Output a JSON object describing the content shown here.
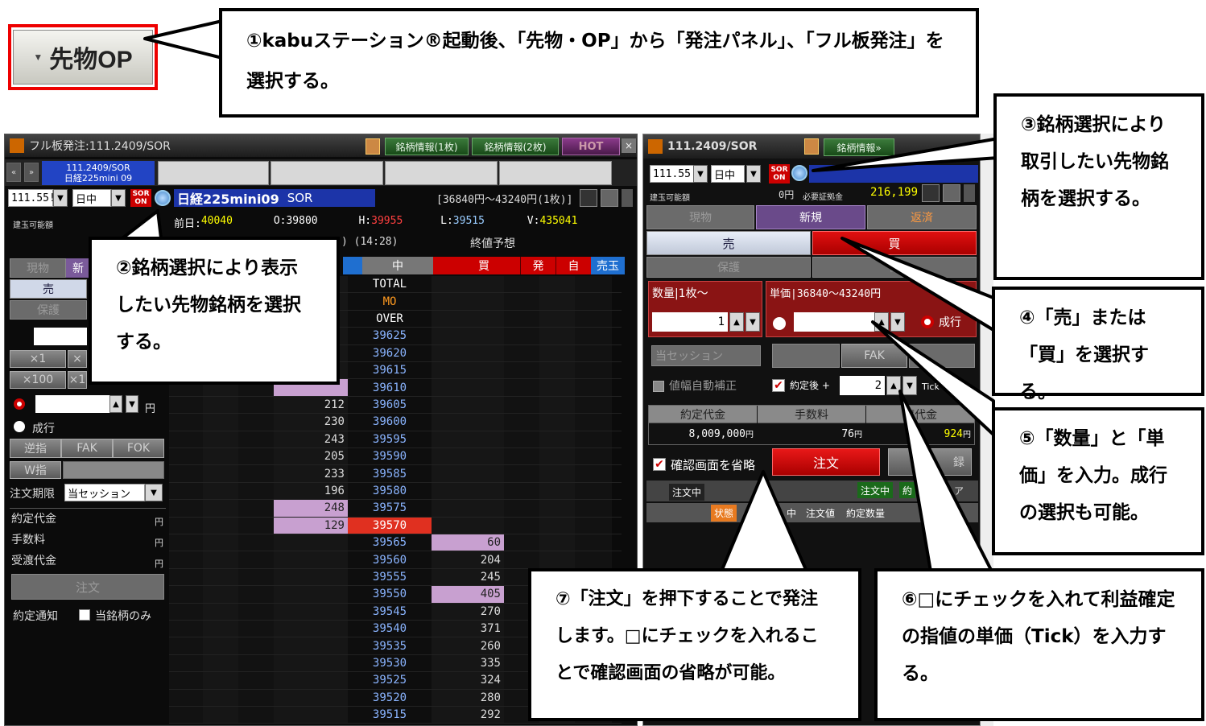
{
  "toolbar_button": {
    "label": "先物OP"
  },
  "left_window": {
    "title": "フル板発注:111.2409/SOR",
    "btn_info1": "銘柄情報(1枚)",
    "btn_info2": "銘柄情報(2枚)",
    "btn_hot": "HOT",
    "close": "×",
    "nav_prev": "«",
    "nav_next": "»",
    "tab_code": "111.2409/SOR",
    "tab_name": "日経225mini 09",
    "code_field": "111.55!",
    "session_select": "日中",
    "sor_label": "SOR ON",
    "symbol_name": "日経225mini09",
    "symbol_sor": "SOR",
    "price_range": "[36840円～43240円(1枚)]",
    "tategyoku": "建玉可能額",
    "prev_close_label": "前日:",
    "prev_close": "40040",
    "open_label": "O:",
    "open": "39800",
    "high_label": "H:",
    "high": "39955",
    "low_label": "L:",
    "low": "39515",
    "volume_label": "V:",
    "volume": "435041",
    "time": ") (14:28)",
    "closing_forecast": "終値予想",
    "panel": {
      "tab_genbutsu": "現物",
      "tab_shinki": "新",
      "sell": "売",
      "hogo": "保護",
      "x1": "×1",
      "x1b": "×",
      "x100": "×100",
      "x100b": "×1",
      "yen": "円",
      "market": "成行",
      "gyakusashi": "逆指",
      "fak": "FAK",
      "fok": "FOK",
      "w_sashi": "W指",
      "period_label": "注文期限",
      "period_value": "当セッション",
      "yakujo": "約定代金",
      "tesuryo": "手数料",
      "jutai": "受渡代金",
      "order": "注文",
      "notice": "約定通知",
      "this_only": "当銘柄のみ"
    },
    "book": {
      "headers": {
        "mid": "中",
        "buy": "買",
        "hatsu": "発",
        "ji": "自",
        "urigyoku": "売玉"
      },
      "rows": [
        {
          "price": "TOTAL",
          "sell": "",
          "buy": ""
        },
        {
          "price": "MO",
          "sell": "",
          "buy": ""
        },
        {
          "price": "OVER",
          "sell": "",
          "buy": ""
        },
        {
          "price": "39625",
          "sell": "",
          "buy": ""
        },
        {
          "price": "39620",
          "sell": "",
          "buy": ""
        },
        {
          "price": "39615",
          "sell": "",
          "buy": ""
        },
        {
          "price": "39610",
          "sell": "",
          "buy": ""
        },
        {
          "price": "39605",
          "sell": "212",
          "buy": ""
        },
        {
          "price": "39600",
          "sell": "230",
          "buy": ""
        },
        {
          "price": "39595",
          "sell": "243",
          "buy": ""
        },
        {
          "price": "39590",
          "sell": "205",
          "buy": ""
        },
        {
          "price": "39585",
          "sell": "233",
          "buy": ""
        },
        {
          "price": "39580",
          "sell": "196",
          "buy": ""
        },
        {
          "price": "39575",
          "sell": "248",
          "buy": ""
        },
        {
          "price": "39570",
          "sell": "129",
          "buy": ""
        },
        {
          "price": "39565",
          "sell": "",
          "buy": "60"
        },
        {
          "price": "39560",
          "sell": "",
          "buy": "204"
        },
        {
          "price": "39555",
          "sell": "",
          "buy": "245"
        },
        {
          "price": "39550",
          "sell": "",
          "buy": "405"
        },
        {
          "price": "39545",
          "sell": "",
          "buy": "270"
        },
        {
          "price": "39540",
          "sell": "",
          "buy": "371"
        },
        {
          "price": "39535",
          "sell": "",
          "buy": "260"
        },
        {
          "price": "39530",
          "sell": "",
          "buy": "335"
        },
        {
          "price": "39525",
          "sell": "",
          "buy": "324"
        },
        {
          "price": "39520",
          "sell": "",
          "buy": "280"
        },
        {
          "price": "39515",
          "sell": "",
          "buy": "292"
        }
      ]
    }
  },
  "right_window": {
    "title": "111.2409/SOR",
    "btn_info": "銘柄情報»",
    "code_field": "111.55!",
    "session_select": "日中",
    "sor_label": "SOR ON",
    "tategyoku": "建玉可能額",
    "zero_yen": "0円",
    "margin_label": "必要証拠金",
    "margin": "216,199",
    "tab_genbutsu": "現物",
    "tab_shinki": "新規",
    "tab_hensai": "返済",
    "sell": "売",
    "buy": "買",
    "hogo": "保護",
    "hogo2": "保",
    "qty_label": "数量|1枚～",
    "qty_value": "1",
    "price_label": "単価|36840～43240円",
    "market": "成行",
    "session": "当セッション",
    "fak": "FAK",
    "auto_adjust": "値幅自動補正",
    "after_fill": "約定後 +",
    "tick_value": "2",
    "tick_sell": "Tickで売り",
    "col_yakujo": "約定代金",
    "col_tesuryo": "手数料",
    "col_jutai": "渡代金",
    "yakujo_value": "8,009,000",
    "tesuryo_value": "76",
    "jutai_value": "924",
    "yen": "円",
    "skip_confirm": "確認画面を省略",
    "order": "注文",
    "register": "録",
    "ordering": "注文中",
    "ordering2": "注文中",
    "yaku": "約",
    "sa": "ア",
    "hdr_status": "状態",
    "hdr_mid": "中",
    "hdr_price": "注文値",
    "hdr_qty": "約定数量"
  },
  "callouts": {
    "c1": "①kabuステーション®起動後、「先物・OP」から「発注パネル」、「フル板発注」を選択する。",
    "c2": "②銘柄選択により表示したい先物銘柄を選択する。",
    "c3": "③銘柄選択により取引したい先物銘柄を選択する。",
    "c4": "④「売」または「買」を選択する。",
    "c5": "⑤「数量」と「単価」を入力。成行の選択も可能。",
    "c6": "⑥□にチェックを入れて利益確定の指値の単価（Tick）を入力する。",
    "c7": "⑦「注文」を押下することで発注します。□にチェックを入れることで確認画面の省略が可能。"
  }
}
